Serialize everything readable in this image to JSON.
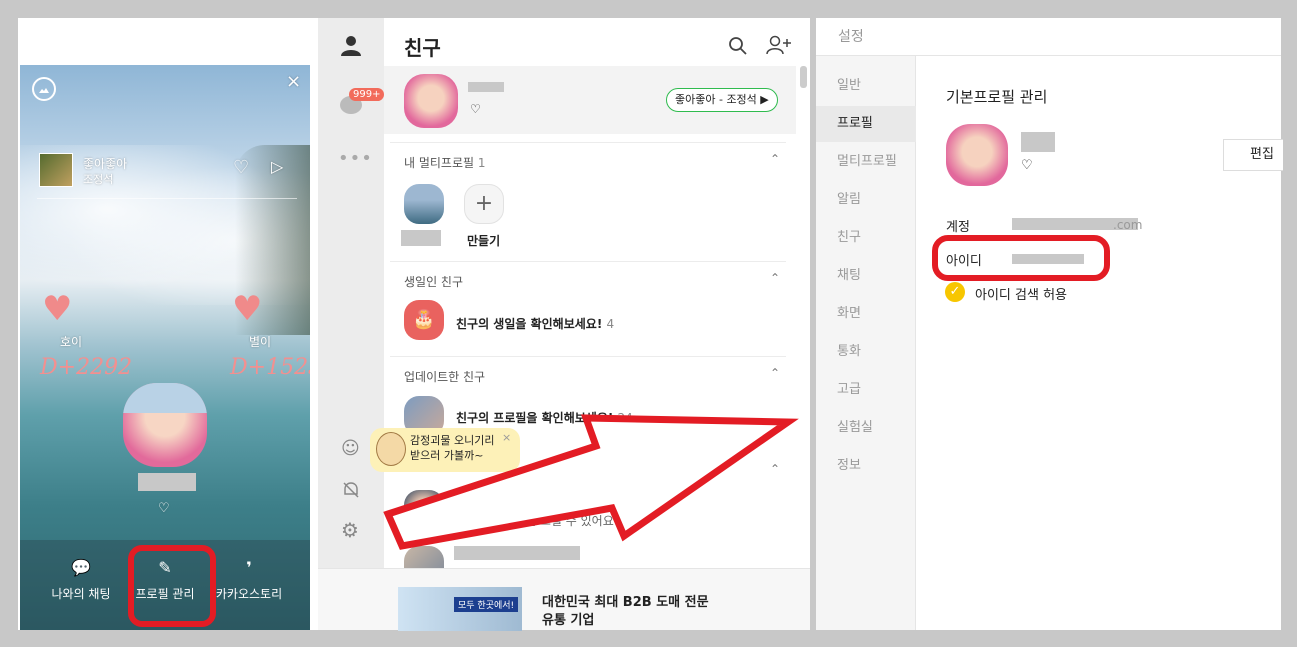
{
  "profile": {
    "song_title": "좋아좋아",
    "song_artist": "조정석",
    "left_name": "호이",
    "left_dday": "D+2292",
    "right_name": "별이",
    "right_dday": "D+1523",
    "heart": "♡",
    "actions": [
      {
        "label": "나와의 채팅"
      },
      {
        "label": "프로필 관리"
      },
      {
        "label": "카카오스토리"
      }
    ]
  },
  "sidebar": {
    "badge": "999+"
  },
  "friends": {
    "title": "친구",
    "my_status_heart": "♡",
    "music_tag": "좋아좋아 - 조정석 ▶",
    "multi_section": "내 멀티프로필",
    "multi_count": "1",
    "create_label": "만들기",
    "birthday_section": "생일인 친구",
    "birthday_text": "친구의 생일을 확인해보세요!",
    "birthday_count": "4",
    "update_section": "업데이트한 친구",
    "update_text": "친구의 프로필을 확인해보세요!",
    "update_count": "24",
    "emoticon_popup_line1": "감정괴물 오니기리",
    "emoticon_popup_line2": "받으러 가볼까~",
    "friend_status_partial": "답변 느릴 수 있어요 :)",
    "ad_line1": "대한민국 최대 B2B 도매 전문",
    "ad_line2": "유통 기업",
    "ad_banner_text": "모두 한곳에서!"
  },
  "settings": {
    "title": "설정",
    "nav": [
      "일반",
      "프로필",
      "멀티프로필",
      "알림",
      "친구",
      "채팅",
      "화면",
      "통화",
      "고급",
      "실험실",
      "정보"
    ],
    "section_title": "기본프로필 관리",
    "heart": "♡",
    "edit_button": "편집",
    "account_label": "계정",
    "account_suffix": ".com",
    "id_label": "아이디",
    "id_search_allow": "아이디 검색 허용"
  },
  "colors": {
    "annotation_red": "#e31c24",
    "checkbox_yellow": "#f7c600",
    "badge_red": "#f26b5b"
  }
}
